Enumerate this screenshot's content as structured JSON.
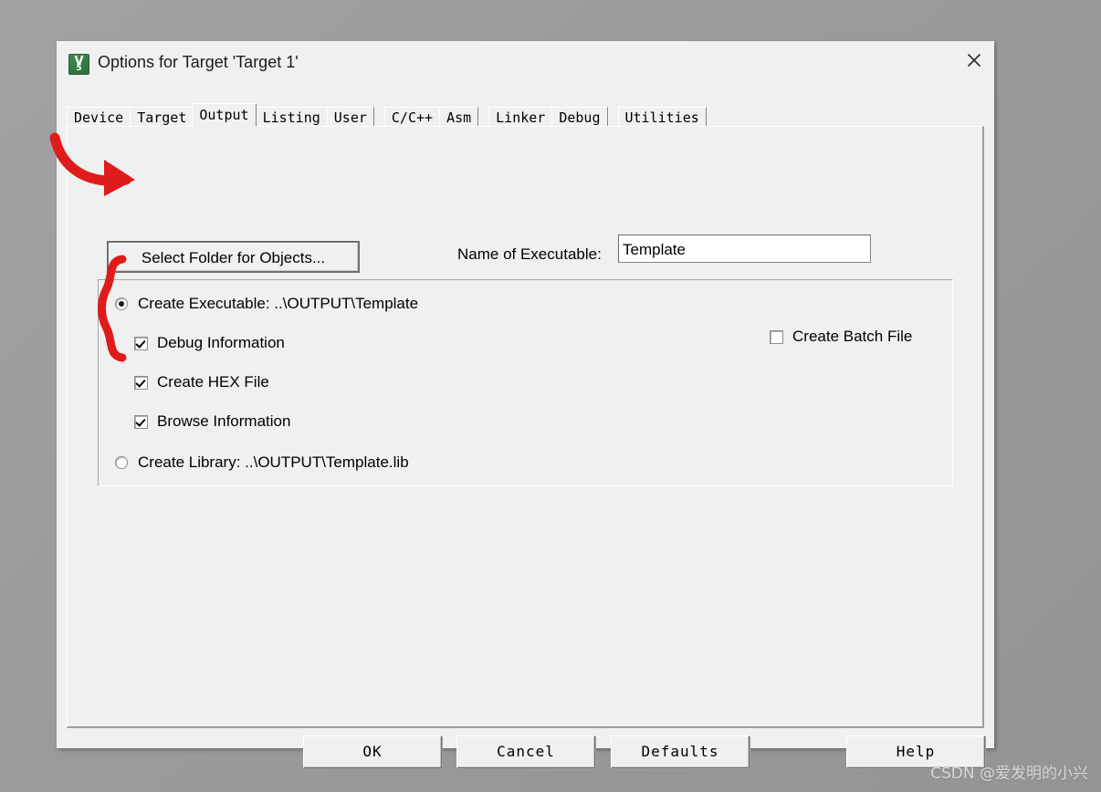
{
  "window": {
    "title": "Options for Target 'Target 1'",
    "icon": "keil-uvision-icon",
    "icon_glyph_top": "V",
    "icon_glyph_bottom": "5",
    "close_icon": "close-icon"
  },
  "tabs": [
    {
      "label": "Device",
      "selected": false
    },
    {
      "label": "Target",
      "selected": false
    },
    {
      "label": "Output",
      "selected": true
    },
    {
      "label": "Listing",
      "selected": false
    },
    {
      "label": "User",
      "selected": false
    },
    {
      "label": "C/C++",
      "selected": false
    },
    {
      "label": "Asm",
      "selected": false
    },
    {
      "label": "Linker",
      "selected": false
    },
    {
      "label": "Debug",
      "selected": false
    },
    {
      "label": "Utilities",
      "selected": false
    }
  ],
  "output_page": {
    "select_folder_button": "Select Folder for Objects...",
    "executable_name_label": "Name of Executable:",
    "executable_name_value": "Template",
    "executable_name_placeholder": "",
    "create_executable": {
      "label": "Create Executable:  ..\\OUTPUT\\Template",
      "checked": true
    },
    "debug_information": {
      "label": "Debug Information",
      "checked": true
    },
    "create_hex_file": {
      "label": "Create HEX File",
      "checked": true
    },
    "browse_information": {
      "label": "Browse Information",
      "checked": true
    },
    "create_batch_file": {
      "label": "Create Batch File",
      "checked": false
    },
    "create_library": {
      "label": "Create Library:  ..\\OUTPUT\\Template.lib",
      "checked": false
    }
  },
  "buttons": {
    "ok": "OK",
    "cancel": "Cancel",
    "defaults": "Defaults",
    "help": "Help"
  },
  "annotations": {
    "arrow_color": "#e01b1b",
    "brace_color": "#e01b1b",
    "arrow_target": "select-folder-button",
    "brace_target": "checkbox-group"
  },
  "watermark": "CSDN @爱发明的小兴"
}
